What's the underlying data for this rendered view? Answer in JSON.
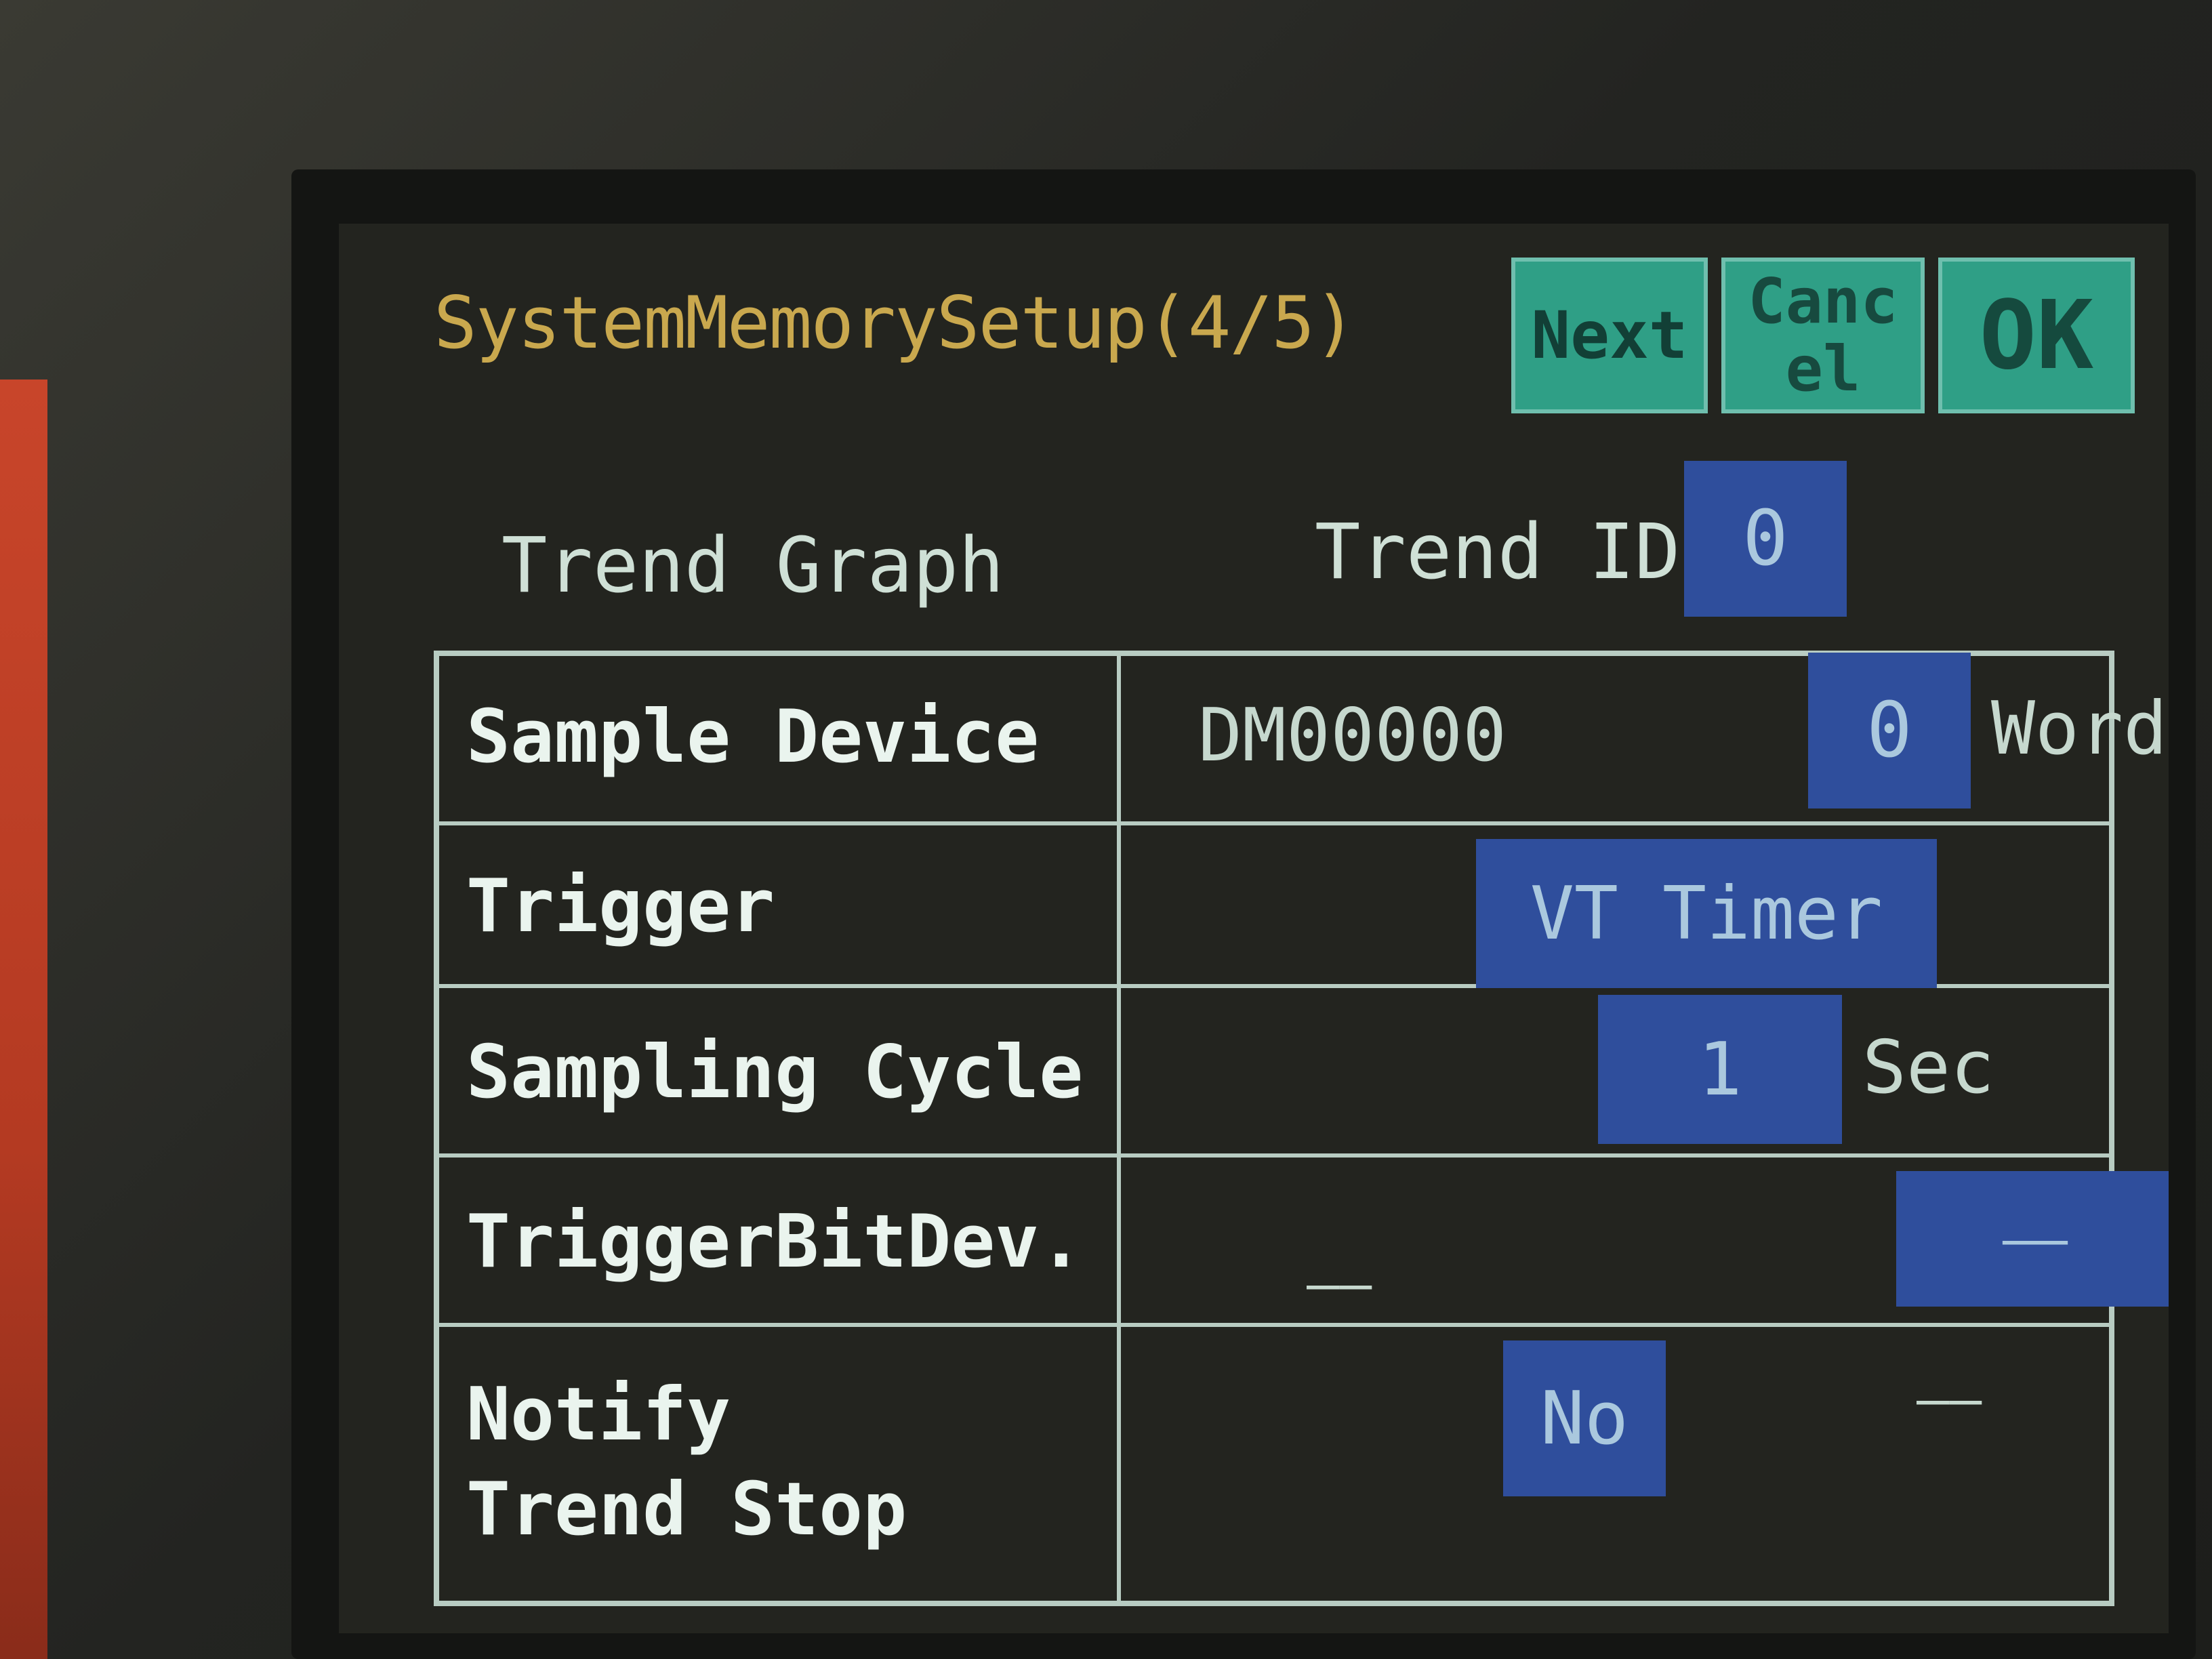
{
  "header": {
    "title": "SystemMemorySetup(4/5)",
    "buttons": {
      "next": "Next",
      "cancel": "Cancel",
      "ok": "OK"
    }
  },
  "section": {
    "label": "Trend Graph",
    "trend_id_label": "Trend ID",
    "trend_id_value": "0"
  },
  "rows": {
    "sample_device": {
      "label": "Sample Device",
      "device": "DM00000",
      "words": "0",
      "unit": "Words"
    },
    "trigger": {
      "label": "Trigger",
      "value": "VT Timer"
    },
    "sampling_cycle": {
      "label": "Sampling Cycle",
      "value": "1",
      "unit": "Sec"
    },
    "trigger_bit_dev": {
      "label": "TriggerBitDev.",
      "value": "——",
      "field_value": "——"
    },
    "notify_trend_stop": {
      "label": "Notify\nTrend Stop",
      "value": "No",
      "extra": "——"
    }
  },
  "colors": {
    "title": "#c9a84e",
    "button_teal": "#2f9f86",
    "field_blue": "#2f4e9c",
    "text": "#cfe0d6",
    "screen_bg": "#23241f"
  }
}
